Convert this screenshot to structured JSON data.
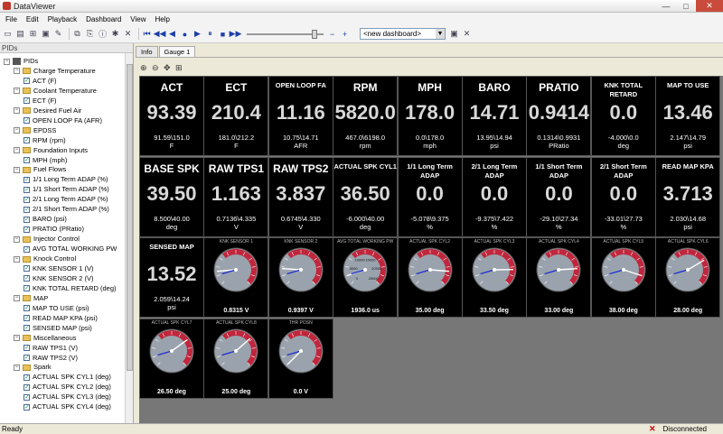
{
  "window": {
    "title": "DataViewer",
    "min": "—",
    "max": "□",
    "close": "✕"
  },
  "menu": [
    "File",
    "Edit",
    "Playback",
    "Dashboard",
    "View",
    "Help"
  ],
  "toolbar": {
    "dashboard_select": "<new dashboard>",
    "plus": "+",
    "minus": "−"
  },
  "panel_title": "PIDs",
  "tree": [
    {
      "level": 0,
      "type": "root",
      "label": "PIDs"
    },
    {
      "level": 1,
      "type": "group",
      "label": "Charge Temperature"
    },
    {
      "level": 2,
      "type": "item",
      "label": "ACT (F)"
    },
    {
      "level": 1,
      "type": "group",
      "label": "Coolant Temperature"
    },
    {
      "level": 2,
      "type": "item",
      "label": "ECT (F)"
    },
    {
      "level": 1,
      "type": "group",
      "label": "Desired Fuel Air"
    },
    {
      "level": 2,
      "type": "item",
      "label": "OPEN LOOP FA (AFR)"
    },
    {
      "level": 1,
      "type": "group",
      "label": "EPDSS"
    },
    {
      "level": 2,
      "type": "item",
      "label": "RPM (rpm)"
    },
    {
      "level": 1,
      "type": "group",
      "label": "Foundation Inputs"
    },
    {
      "level": 2,
      "type": "item",
      "label": "MPH (mph)"
    },
    {
      "level": 1,
      "type": "group",
      "label": "Fuel Flows"
    },
    {
      "level": 2,
      "type": "item",
      "label": "1/1 Long Term ADAP (%)"
    },
    {
      "level": 2,
      "type": "item",
      "label": "1/1 Short Term ADAP (%)"
    },
    {
      "level": 2,
      "type": "item",
      "label": "2/1 Long Term ADAP (%)"
    },
    {
      "level": 2,
      "type": "item",
      "label": "2/1 Short Term ADAP (%)"
    },
    {
      "level": 2,
      "type": "item",
      "label": "BARO (psi)"
    },
    {
      "level": 2,
      "type": "item",
      "label": "PRATIO (PRatio)"
    },
    {
      "level": 1,
      "type": "group",
      "label": "Injector Control"
    },
    {
      "level": 2,
      "type": "item",
      "label": "AVG TOTAL WORKING PW"
    },
    {
      "level": 1,
      "type": "group",
      "label": "Knock Control"
    },
    {
      "level": 2,
      "type": "item",
      "label": "KNK SENSOR 1 (V)"
    },
    {
      "level": 2,
      "type": "item",
      "label": "KNK SENSOR 2 (V)"
    },
    {
      "level": 2,
      "type": "item",
      "label": "KNK TOTAL RETARD (deg)"
    },
    {
      "level": 1,
      "type": "group",
      "label": "MAP"
    },
    {
      "level": 2,
      "type": "item",
      "label": "MAP TO USE (psi)"
    },
    {
      "level": 2,
      "type": "item",
      "label": "READ MAP KPA (psi)"
    },
    {
      "level": 2,
      "type": "item",
      "label": "SENSED MAP (psi)"
    },
    {
      "level": 1,
      "type": "group",
      "label": "Miscellaneous"
    },
    {
      "level": 2,
      "type": "item",
      "label": "RAW TPS1 (V)"
    },
    {
      "level": 2,
      "type": "item",
      "label": "RAW TPS2 (V)"
    },
    {
      "level": 1,
      "type": "group",
      "label": "Spark"
    },
    {
      "level": 2,
      "type": "item",
      "label": "ACTUAL SPK CYL1 (deg)"
    },
    {
      "level": 2,
      "type": "item",
      "label": "ACTUAL SPK CYL2 (deg)"
    },
    {
      "level": 2,
      "type": "item",
      "label": "ACTUAL SPK CYL3 (deg)"
    },
    {
      "level": 2,
      "type": "item",
      "label": "ACTUAL SPK CYL4 (deg)"
    }
  ],
  "tabs": [
    "Info",
    "Gauge 1"
  ],
  "digital_tiles": [
    {
      "name": "ACT",
      "size": "big",
      "value": "93.39",
      "range": "91.59\\151.0",
      "unit": "F"
    },
    {
      "name": "ECT",
      "size": "big",
      "value": "210.4",
      "range": "181.0\\212.2",
      "unit": "F"
    },
    {
      "name": "OPEN LOOP FA",
      "size": "small",
      "value": "11.16",
      "range": "10.75\\14.71",
      "unit": "AFR"
    },
    {
      "name": "RPM",
      "size": "big",
      "value": "5820.0",
      "range": "467.0\\6198.0",
      "unit": "rpm"
    },
    {
      "name": "MPH",
      "size": "big",
      "value": "178.0",
      "range": "0.0\\178.0",
      "unit": "mph"
    },
    {
      "name": "BARO",
      "size": "big",
      "value": "14.71",
      "range": "13.95\\14.94",
      "unit": "psi"
    },
    {
      "name": "PRATIO",
      "size": "big",
      "value": "0.9414",
      "range": "0.1314\\0.9931",
      "unit": "PRatio"
    },
    {
      "name": "KNK TOTAL RETARD",
      "size": "small",
      "value": "0.0",
      "range": "-4.000\\0.0",
      "unit": "deg"
    },
    {
      "name": "MAP TO USE",
      "size": "small",
      "value": "13.46",
      "range": "2.147\\14.79",
      "unit": "psi"
    },
    {
      "name": "BASE SPK",
      "size": "big",
      "value": "39.50",
      "range": "8.500\\40.00",
      "unit": "deg"
    },
    {
      "name": "RAW TPS1",
      "size": "big",
      "value": "1.163",
      "range": "0.7136\\4.335",
      "unit": "V"
    },
    {
      "name": "RAW TPS2",
      "size": "big",
      "value": "3.837",
      "range": "0.6745\\4.330",
      "unit": "V"
    },
    {
      "name": "ACTUAL SPK CYL1",
      "size": "small",
      "value": "36.50",
      "range": "-6.000\\40.00",
      "unit": "deg"
    },
    {
      "name": "1/1 Long Term ADAP",
      "size": "small",
      "value": "0.0",
      "range": "-5.078\\9.375",
      "unit": "%"
    },
    {
      "name": "2/1 Long Term ADAP",
      "size": "small",
      "value": "0.0",
      "range": "-9.375\\7.422",
      "unit": "%"
    },
    {
      "name": "1/1 Short Term ADAP",
      "size": "small",
      "value": "0.0",
      "range": "-29.10\\27.34",
      "unit": "%"
    },
    {
      "name": "2/1 Short Term ADAP",
      "size": "small",
      "value": "0.0",
      "range": "-33.01\\27.73",
      "unit": "%"
    },
    {
      "name": "READ MAP KPA",
      "size": "small",
      "value": "3.713",
      "range": "2.030\\14.68",
      "unit": "psi"
    },
    {
      "name": "SENSED MAP",
      "size": "small",
      "value": "13.52",
      "range": "2.059\\14.24",
      "unit": "psi"
    }
  ],
  "gauge_tiles": [
    {
      "name": "KNK SENSOR 1",
      "value": "0.8315 V",
      "needle": 0.15
    },
    {
      "name": "KNK SENSOR 2",
      "value": "0.9397 V",
      "needle": 0.18
    },
    {
      "name": "AVG TOTAL WORKING PW",
      "value": "1936.0 us",
      "needle": 0.1
    },
    {
      "name": "ACTUAL SPK CYL2",
      "value": "35.00 deg",
      "needle": 0.85
    },
    {
      "name": "ACTUAL SPK CYL3",
      "value": "33.50 deg",
      "needle": 0.83
    },
    {
      "name": "ACTUAL SPK CYL4",
      "value": "33.00 deg",
      "needle": 0.82
    },
    {
      "name": "ACTUAL SPK CYL5",
      "value": "38.00 deg",
      "needle": 0.9
    },
    {
      "name": "ACTUAL SPK CYL6",
      "value": "28.00 deg",
      "needle": 0.72
    },
    {
      "name": "ACTUAL SPK CYL7",
      "value": "26.50 deg",
      "needle": 0.7
    },
    {
      "name": "ACTUAL SPK CYL8",
      "value": "25.00 deg",
      "needle": 0.68
    },
    {
      "name": "THR POSN",
      "value": "0.0 V",
      "needle": 0.0
    }
  ],
  "gauge_scale_labels": [
    "0",
    "5000",
    "10000",
    "15000",
    "20000",
    "25000"
  ],
  "status": {
    "left": "Ready",
    "right": "Disconnected"
  },
  "colors": {
    "tile_bg": "#000000",
    "arc_red": "#c0263c",
    "needle": "#ffffff",
    "needle_low": "#2030d0"
  }
}
